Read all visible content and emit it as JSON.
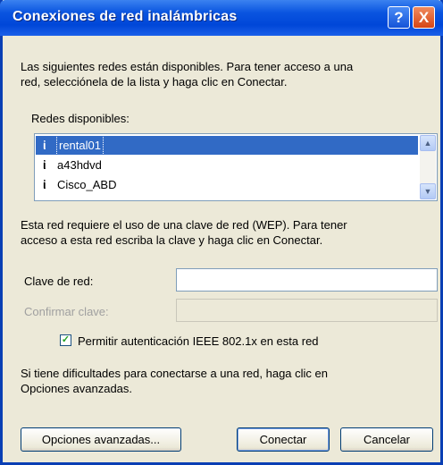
{
  "window": {
    "title": "Conexiones de red inalámbricas",
    "help_label": "?",
    "close_label": "X"
  },
  "intro_text_line1": "Las siguientes redes están disponibles. Para tener acceso a una",
  "intro_text_line2": "red, selecciónela de la lista y haga clic en Conectar.",
  "networks_label": "Redes disponibles:",
  "networks": [
    {
      "name": "rental01",
      "icon": "wireless-network-icon",
      "selected": true
    },
    {
      "name": "a43hdvd",
      "icon": "wireless-network-icon",
      "selected": false
    },
    {
      "name": "Cisco_ABD",
      "icon": "wireless-network-icon",
      "selected": false
    }
  ],
  "wep_text_line1": "Esta red requiere el uso de una clave de red (WEP). Para tener",
  "wep_text_line2": "acceso a esta red escriba la clave y haga clic en Conectar.",
  "key_label": "Clave de red:",
  "key_value": "",
  "confirm_label": "Confirmar clave:",
  "confirm_value": "",
  "checkbox_label": "Permitir autenticación IEEE 802.1x en esta red",
  "checkbox_checked": true,
  "help_text_line1": "Si tiene dificultades para conectarse a una red, haga clic en",
  "help_text_line2": "Opciones avanzadas.",
  "buttons": {
    "advanced": "Opciones avanzadas...",
    "connect": "Conectar",
    "cancel": "Cancelar"
  }
}
